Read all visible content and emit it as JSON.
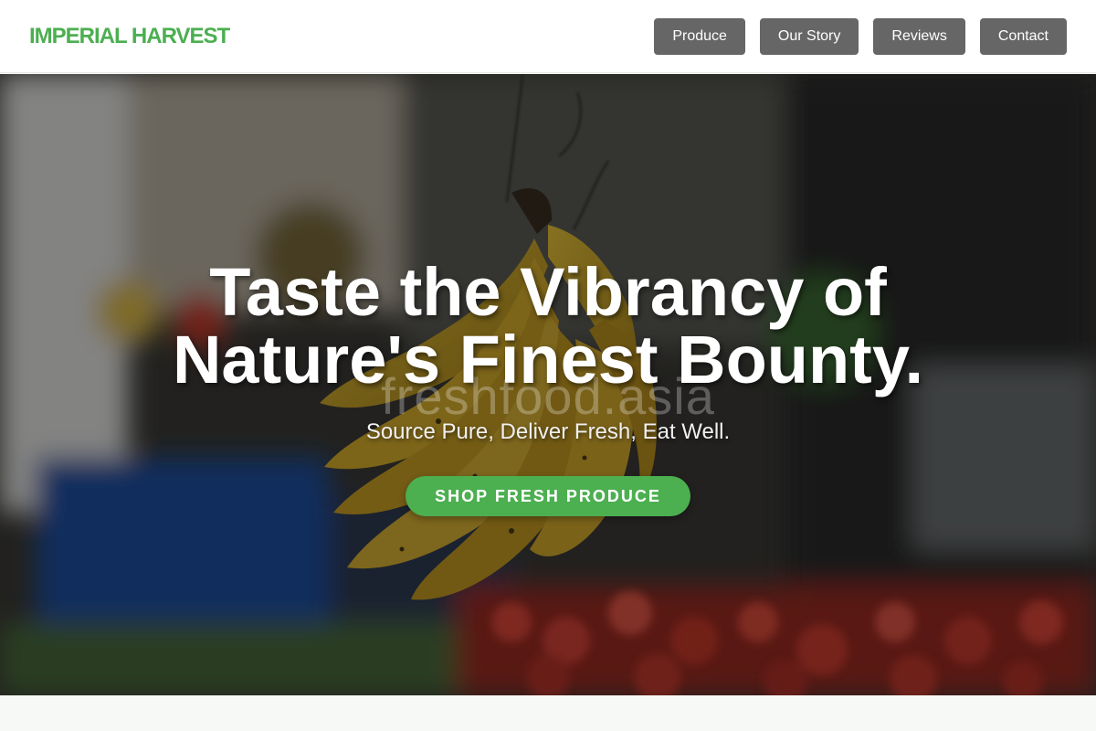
{
  "brand": {
    "logo_text": "IMPERIAL HARVEST"
  },
  "nav": {
    "items": [
      {
        "label": "Produce"
      },
      {
        "label": "Our Story"
      },
      {
        "label": "Reviews"
      },
      {
        "label": "Contact"
      }
    ]
  },
  "hero": {
    "title_line1": "Taste the Vibrancy of",
    "title_line2": "Nature's Finest Bounty.",
    "subtitle": "Source Pure, Deliver Fresh, Eat Well.",
    "cta_label": "SHOP FRESH PRODUCE",
    "watermark": "freshfood.asia"
  },
  "colors": {
    "brand_green": "#4caf50",
    "nav_button": "#666666",
    "header_bg": "#ffffff"
  }
}
